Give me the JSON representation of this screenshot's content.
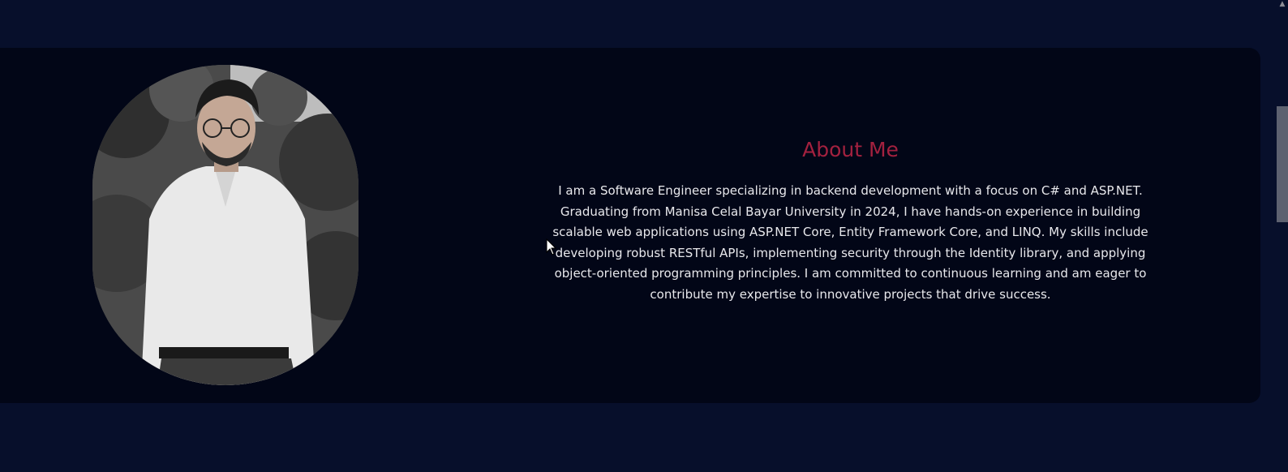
{
  "about": {
    "heading": "About Me",
    "body": "I am a Software Engineer specializing in backend development with a focus on C# and ASP.NET. Graduating from Manisa Celal Bayar University in 2024, I have hands-on experience in building scalable web applications using ASP.NET Core, Entity Framework Core, and LINQ. My skills include developing robust RESTful APIs, implementing security through the Identity library, and applying object-oriented programming principles. I am committed to continuous learning and am eager to contribute my expertise to innovative projects that drive success."
  },
  "colors": {
    "page_background": "#070f2b",
    "card_background": "#020617",
    "heading_accent": "#a3213f",
    "body_text": "#e8e8ec"
  },
  "icons": {
    "scroll_up": "chevron-up-icon",
    "cursor": "mouse-pointer-icon"
  }
}
